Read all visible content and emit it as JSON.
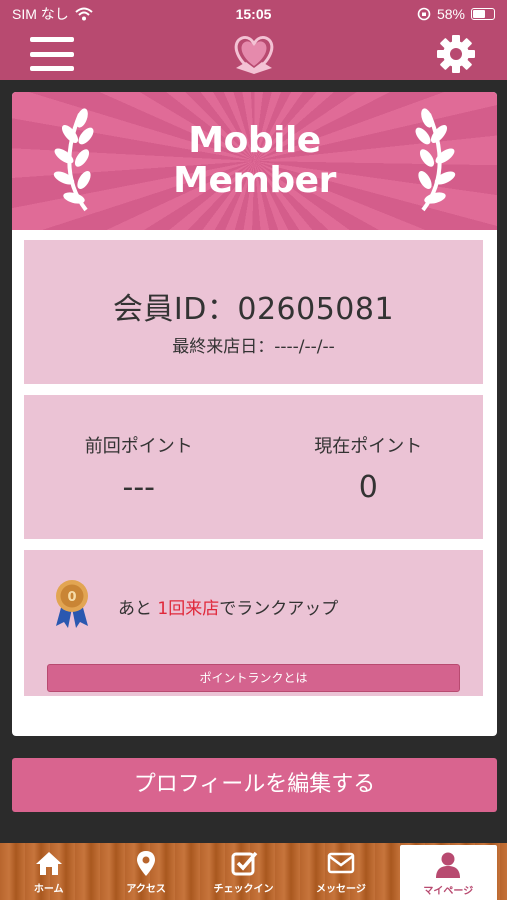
{
  "status_bar": {
    "carrier": "SIM なし",
    "time": "15:05",
    "battery": "58%"
  },
  "banner": {
    "title_line1": "Mobile",
    "title_line2": "Member"
  },
  "member": {
    "id_text": "会員ID：02605081",
    "last_visit": "最終来店日：----/--/--"
  },
  "points": {
    "previous_label": "前回ポイント",
    "previous_value": "---",
    "current_label": "現在ポイント",
    "current_value": "0"
  },
  "rank": {
    "prefix": "あと ",
    "highlight": "1回来店",
    "suffix": "でランクアップ",
    "button_label": "ポイントランクとは"
  },
  "profile_button": "プロフィールを編集する",
  "tabs": [
    {
      "label": "ホーム",
      "icon": "home-icon"
    },
    {
      "label": "アクセス",
      "icon": "map-pin-icon"
    },
    {
      "label": "チェックイン",
      "icon": "checkin-icon"
    },
    {
      "label": "メッセージ",
      "icon": "envelope-icon"
    },
    {
      "label": "マイページ",
      "icon": "user-icon"
    }
  ],
  "colors": {
    "brand": "#b84a70",
    "panel": "#ebc3d5",
    "highlight": "#e0283a"
  }
}
